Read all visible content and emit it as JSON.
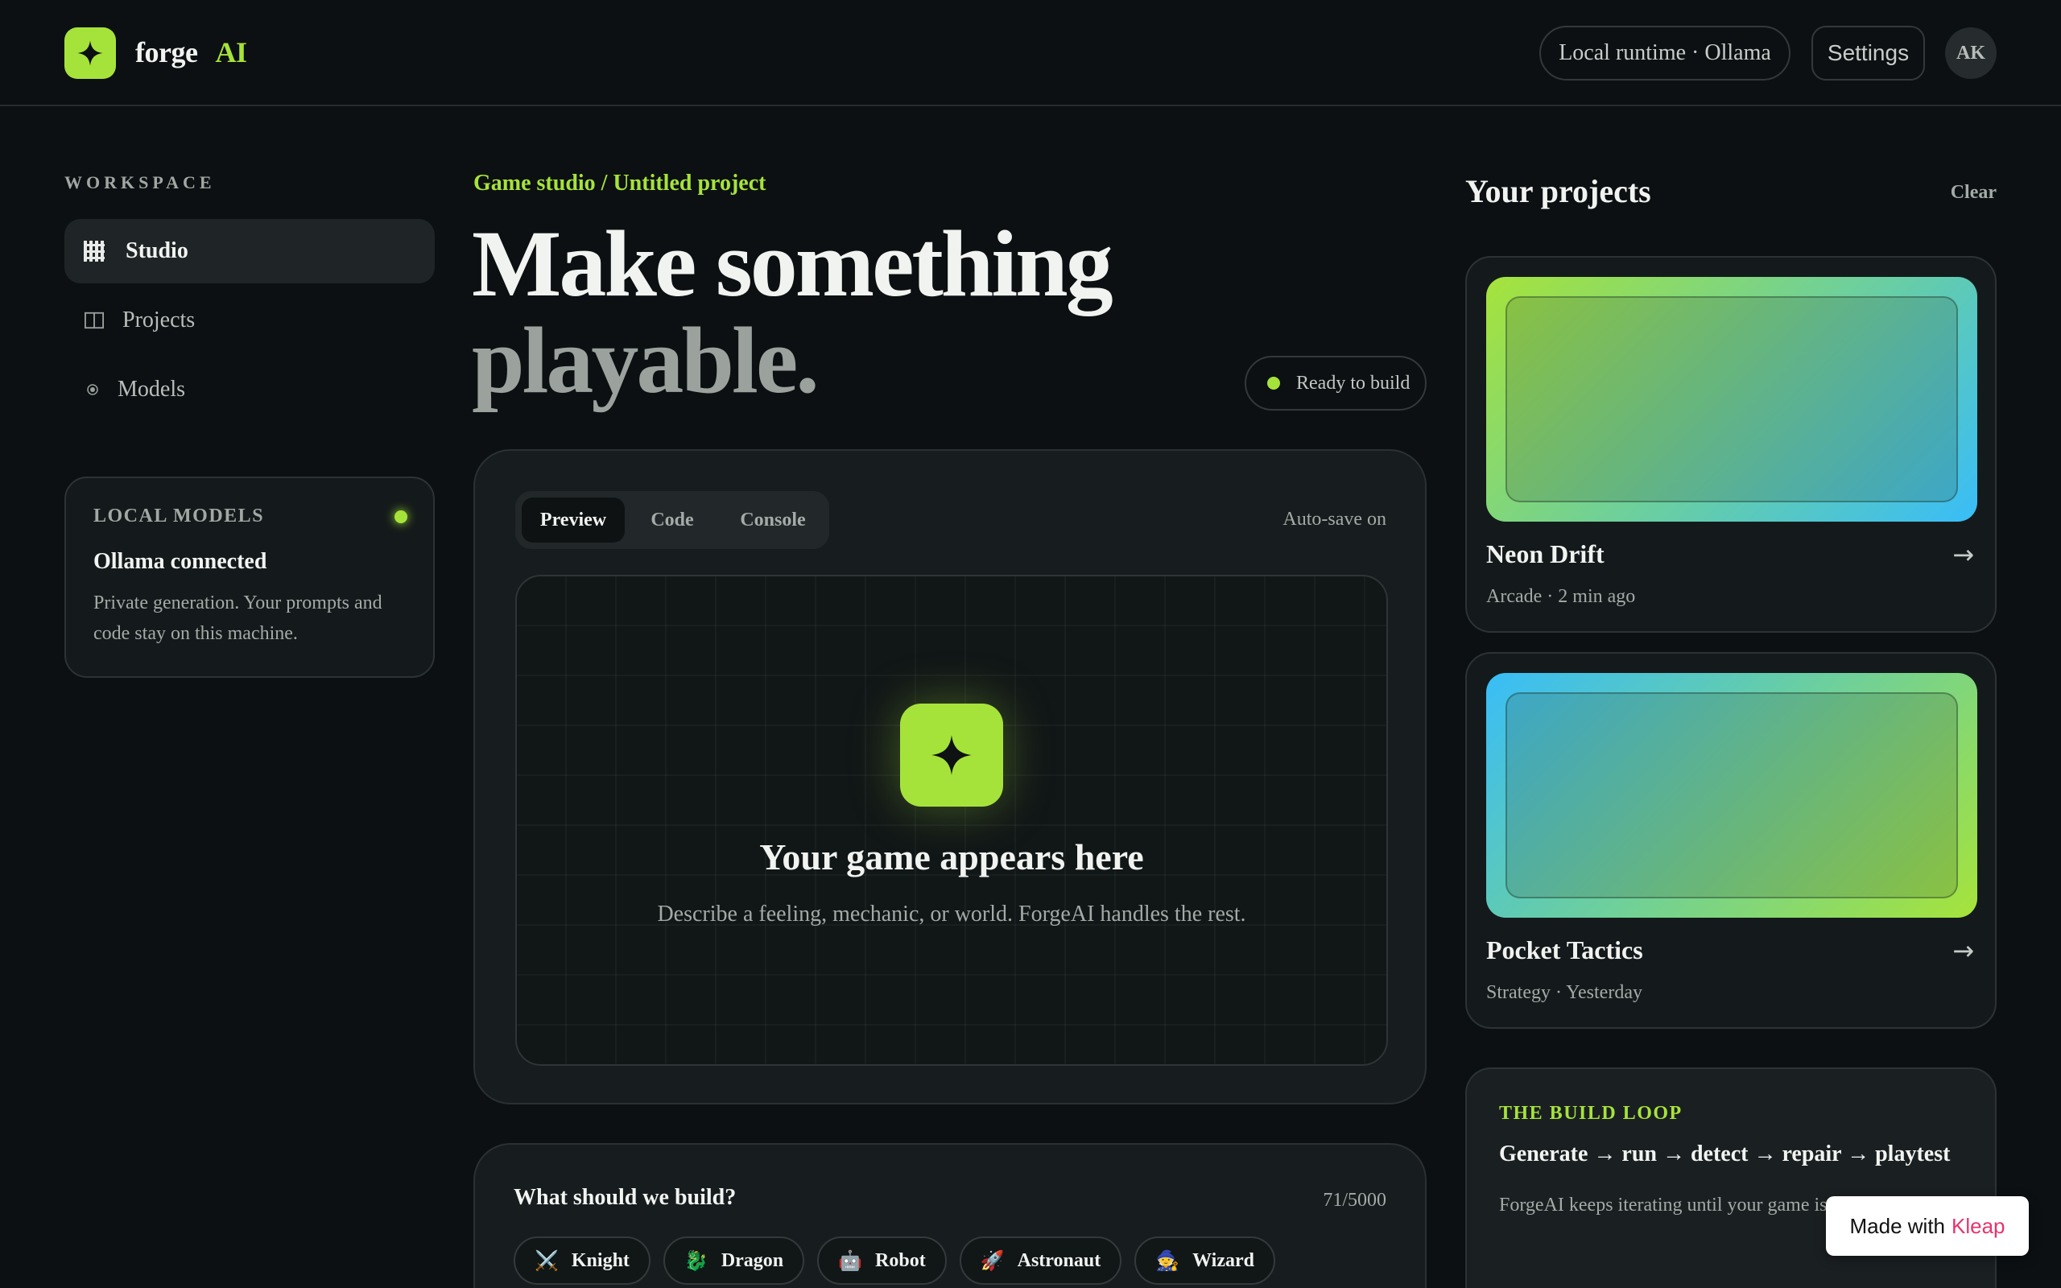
{
  "header": {
    "brand_first": "forge",
    "brand_second": "AI",
    "runtime_pill": "Local runtime · Ollama",
    "settings_label": "Settings",
    "avatar_initials": "AK",
    "logo_icon": "sparkle-icon",
    "accent_color": "#a6e33a"
  },
  "sidebar": {
    "section_label": "WORKSPACE",
    "items": [
      {
        "label": "Studio",
        "icon": "grid-icon",
        "active": true
      },
      {
        "label": "Projects",
        "icon": "panels-icon",
        "active": false
      },
      {
        "label": "Models",
        "icon": "dot-icon",
        "active": false
      }
    ],
    "local_models": {
      "title": "LOCAL MODELS",
      "status": "Ollama connected",
      "description": "Private generation. Your prompts and code stay on this machine."
    }
  },
  "main": {
    "breadcrumb": "Game studio / Untitled project",
    "headline_line1": "Make something",
    "headline_line2": "playable.",
    "status_pill": "Ready to build",
    "tabs": [
      {
        "label": "Preview",
        "active": true
      },
      {
        "label": "Code",
        "active": false
      },
      {
        "label": "Console",
        "active": false
      }
    ],
    "autosave": "Auto-save on",
    "preview": {
      "icon": "sparkle-icon",
      "title": "Your game appears here",
      "subtitle": "Describe a feeling, mechanic, or world. ForgeAI handles the rest."
    },
    "prompt": {
      "question": "What should we build?",
      "counter": "71/5000",
      "chips": [
        {
          "emoji": "⚔️",
          "label": "Knight"
        },
        {
          "emoji": "🐉",
          "label": "Dragon"
        },
        {
          "emoji": "🤖",
          "label": "Robot"
        },
        {
          "emoji": "🚀",
          "label": "Astronaut"
        },
        {
          "emoji": "🧙",
          "label": "Wizard"
        }
      ]
    }
  },
  "projects": {
    "title": "Your projects",
    "clear_label": "Clear",
    "items": [
      {
        "name": "Neon Drift",
        "meta": "Arcade · 2 min ago",
        "arrow": "→",
        "gradient_from": "#a6e33a",
        "gradient_to": "#38bdf8"
      },
      {
        "name": "Pocket Tactics",
        "meta": "Strategy · Yesterday",
        "arrow": "→",
        "gradient_from": "#38bdf8",
        "gradient_to": "#a6e33a"
      }
    ],
    "build_loop": {
      "title": "THE BUILD LOOP",
      "flow": "Generate → run → detect → repair → playtest",
      "description": "ForgeAI keeps iterating until your game is ready to ship."
    }
  },
  "badge": {
    "made_with": "Made with",
    "brand": "Kleap"
  }
}
